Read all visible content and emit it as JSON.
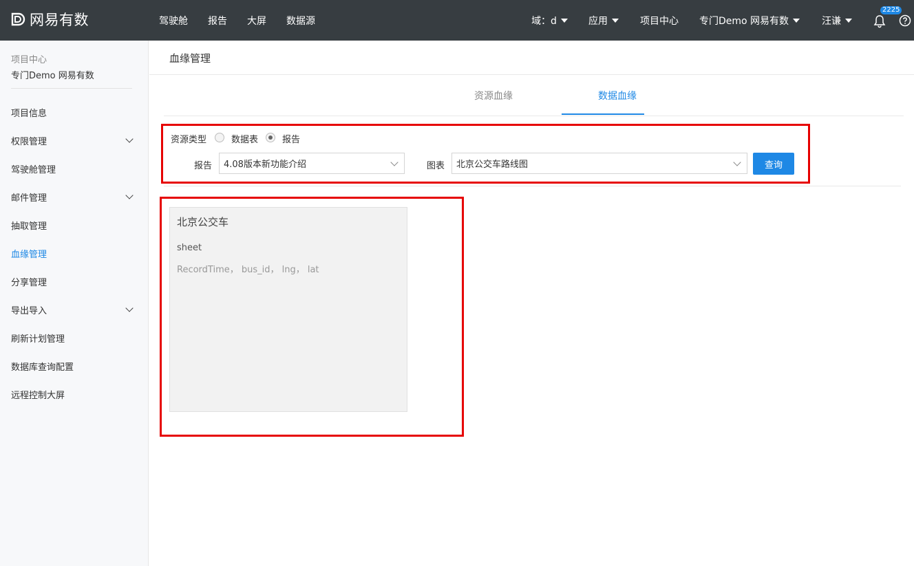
{
  "brand": {
    "name": "网易有数"
  },
  "topnav": {
    "items": [
      "驾驶舱",
      "报告",
      "大屏",
      "数据源"
    ]
  },
  "topright": {
    "domain": "域：d",
    "apps": "应用",
    "project_center": "项目中心",
    "project": "专门Demo 网易有数",
    "user": "汪谦",
    "notification_count": "2225"
  },
  "sidebar": {
    "header_small": "项目中心",
    "header_name": "专门Demo 网易有数",
    "items": [
      {
        "label": "项目信息",
        "expandable": false
      },
      {
        "label": "权限管理",
        "expandable": true
      },
      {
        "label": "驾驶舱管理",
        "expandable": false
      },
      {
        "label": "邮件管理",
        "expandable": true
      },
      {
        "label": "抽取管理",
        "expandable": false
      },
      {
        "label": "血缘管理",
        "expandable": false,
        "active": true
      },
      {
        "label": "分享管理",
        "expandable": false
      },
      {
        "label": "导出导入",
        "expandable": true
      },
      {
        "label": "刷新计划管理",
        "expandable": false
      },
      {
        "label": "数据库查询配置",
        "expandable": false
      },
      {
        "label": "远程控制大屏",
        "expandable": false
      }
    ]
  },
  "main": {
    "title": "血缘管理",
    "tabs": [
      {
        "label": "资源血缘",
        "active": false
      },
      {
        "label": "数据血缘",
        "active": true
      }
    ],
    "filter": {
      "resource_type_label": "资源类型",
      "options": [
        {
          "label": "数据表",
          "checked": false
        },
        {
          "label": "报告",
          "checked": true
        }
      ],
      "report_label": "报告",
      "report_value": "4.08版本新功能介绍",
      "chart_label": "图表",
      "chart_value": "北京公交车路线图",
      "query_button": "查询"
    },
    "card": {
      "title": "北京公交车",
      "sheet": "sheet",
      "fields": "RecordTime， bus_id， lng， lat"
    }
  },
  "colors": {
    "topbar": "#373d41",
    "accent": "#1e88e5",
    "highlight_box": "#e60000",
    "sidebar_bg": "#f7f8fa",
    "card_bg": "#f2f2f2"
  },
  "icons": [
    "logo-icon",
    "caret-down-icon",
    "bell-icon",
    "help-icon",
    "chevron-down-icon"
  ]
}
